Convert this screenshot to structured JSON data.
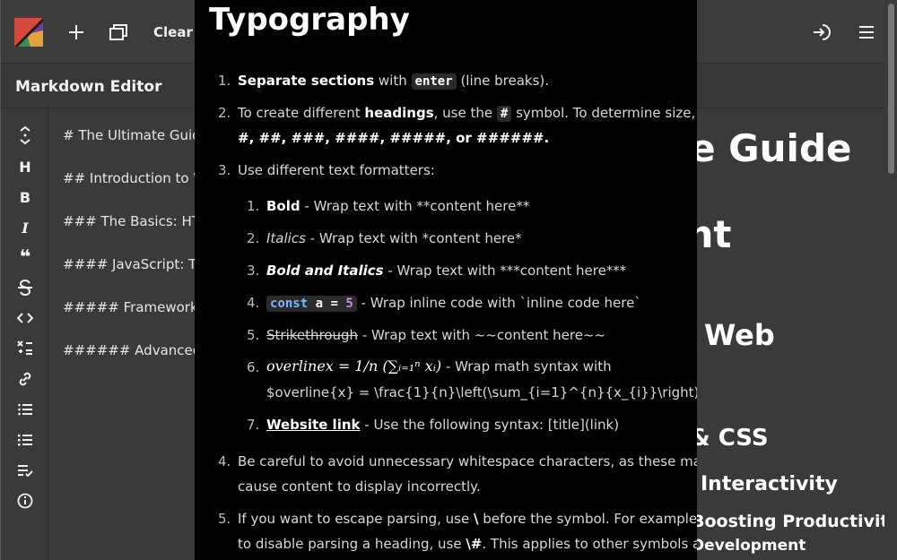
{
  "toolbar": {
    "clear_label": "Clear",
    "icons": [
      "app-logo",
      "plus-icon",
      "new-window-icon",
      "login-icon",
      "menu-icon"
    ]
  },
  "app": {
    "title": "Markdown Editor"
  },
  "rail": {
    "items": [
      {
        "name": "collapse-icon",
        "glyph": "⇕"
      },
      {
        "name": "heading-icon",
        "glyph": "H"
      },
      {
        "name": "bold-icon",
        "glyph": "B"
      },
      {
        "name": "italic-icon",
        "glyph": "I"
      },
      {
        "name": "quote-icon",
        "glyph": "❝"
      },
      {
        "name": "strikethrough-icon",
        "glyph": "S"
      },
      {
        "name": "code-icon",
        "glyph": "<>"
      },
      {
        "name": "math-icon",
        "glyph": "×="
      },
      {
        "name": "link-icon",
        "glyph": "🔗"
      },
      {
        "name": "ordered-list-icon",
        "glyph": "≡"
      },
      {
        "name": "unordered-list-icon",
        "glyph": "≡"
      },
      {
        "name": "checklist-icon",
        "glyph": "≡"
      },
      {
        "name": "info-icon",
        "glyph": "ⓘ"
      }
    ]
  },
  "editor": {
    "lines": [
      "# The Ultimate Guide",
      "## Introduction to W",
      "### The Basics: HTM",
      "#### JavaScript: The",
      "##### Frameworks a",
      "###### Advanced To"
    ]
  },
  "preview": {
    "lines": [
      "te Guide",
      "ent",
      "Web",
      "& CSS",
      "Interactivity",
      "Boosting Productivity",
      "Development"
    ]
  },
  "modal": {
    "title": "Typography",
    "item1": {
      "num": "1.",
      "bold": "Separate sections",
      "pre": " with ",
      "kbd": "enter",
      "post": " (line breaks)."
    },
    "item2": {
      "num": "2.",
      "a": "To create different ",
      "b": "headings",
      "c": ", use the ",
      "kbd": "#",
      "d": " symbol. To determine size, use",
      "e": "#, ##, ###, ####, #####, or ######."
    },
    "item3": {
      "num": "3.",
      "text": "Use different text formatters:"
    },
    "sub": [
      {
        "num": "1.",
        "label": "Bold",
        "text": " - Wrap text with **content here**"
      },
      {
        "num": "2.",
        "label": "Italics",
        "text": " - Wrap text with *content here*"
      },
      {
        "num": "3.",
        "label": "Bold and Italics",
        "text": " - Wrap text with ***content here***"
      },
      {
        "num": "4.",
        "code_kw": "const",
        "code_mid": " a = ",
        "code_num": "5",
        "text": " - Wrap inline code with `inline code here`"
      },
      {
        "num": "5.",
        "label": "Strikethrough",
        "text": " - Wrap text with ~~content here~~"
      },
      {
        "num": "6.",
        "math": "overlinex = 1/n (∑ᵢ₌₁ⁿ xᵢ)",
        "text": " - Wrap math syntax with",
        "text2": "$overline{x} = \\frac{1}{n}\\left(\\sum_{i=1}^{n}{x_{i}}\\right)$"
      },
      {
        "num": "7.",
        "label": "Website link",
        "text": " - Use the following syntax: [title](link)"
      }
    ],
    "item4": {
      "num": "4.",
      "l1": "Be careful to avoid unnecessary whitespace characters, as these may",
      "l2": "cause content to display incorrectly."
    },
    "item5": {
      "num": "5.",
      "l1a": "If you want to escape parsing, use ",
      "l1b": "\\",
      "l1c": " before the symbol. For example,",
      "l2a": "to disable parsing a heading, use ",
      "l2b": "\\#",
      "l2c": ". This applies to other symbols as"
    }
  },
  "colors": {
    "background": "#3a3a3a",
    "modal": "#000000",
    "code_keyword": "#79b8ff",
    "code_number": "#c792ea"
  }
}
